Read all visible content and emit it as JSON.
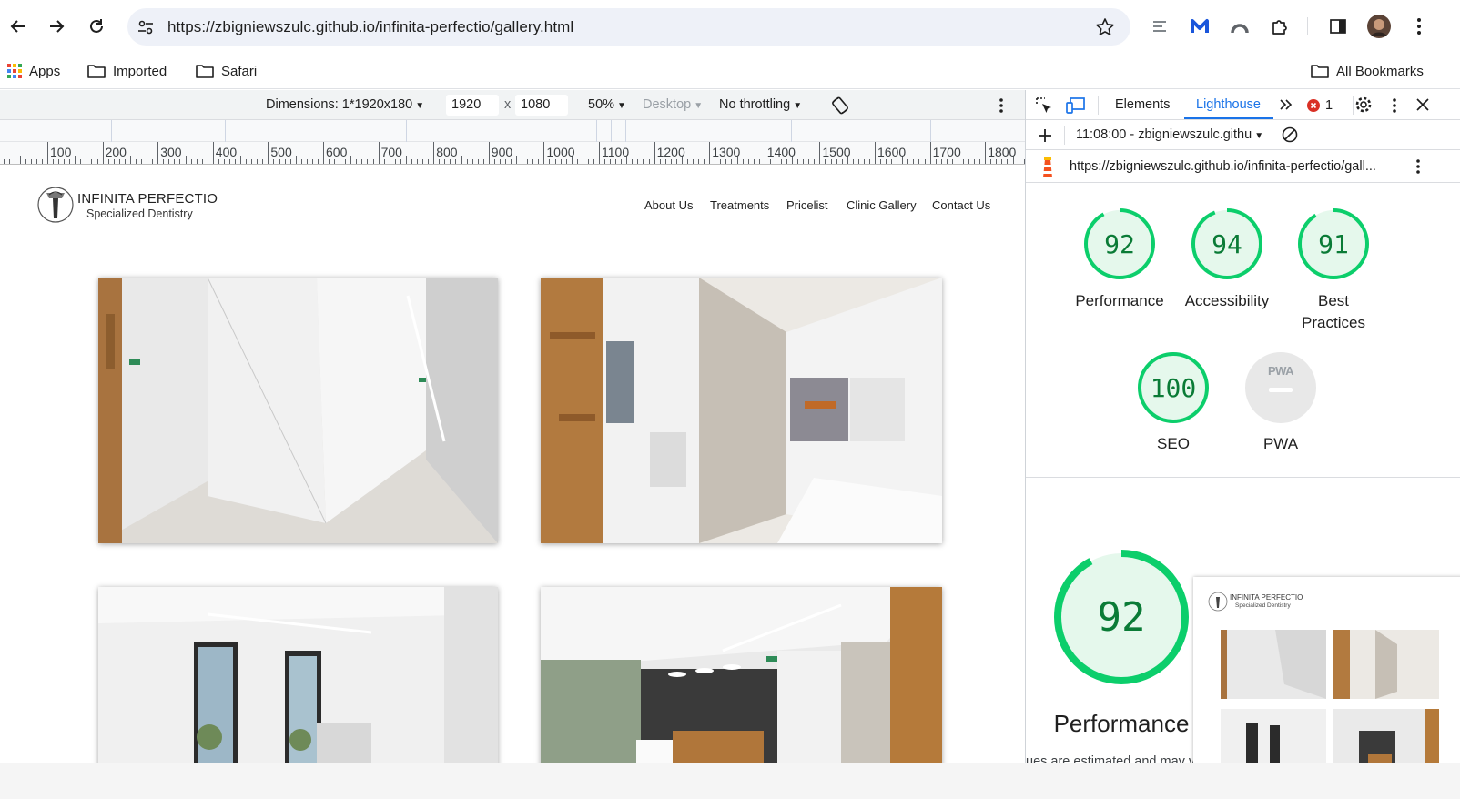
{
  "browser": {
    "url": "https://zbigniewszulc.github.io/infinita-perfectio/gallery.html",
    "bookmarks": [
      "Apps",
      "Imported",
      "Safari"
    ],
    "all_bookmarks": "All Bookmarks"
  },
  "device_toolbar": {
    "dimensions": "Dimensions: 1*1920x180",
    "width": "1920",
    "times": "x",
    "height": "1080",
    "zoom": "50%",
    "device_type": "Desktop",
    "throttling": "No throttling",
    "ruler_labels": [
      "100",
      "200",
      "300",
      "400",
      "500",
      "600",
      "700",
      "800",
      "900",
      "1000",
      "1100",
      "1200",
      "1300",
      "1400",
      "1500",
      "1600",
      "1700",
      "1800"
    ]
  },
  "site": {
    "brand_name": "INFINITA PERFECTIO",
    "brand_tagline": "Specialized Dentistry",
    "nav": [
      "About Us",
      "Treatments",
      "Pricelist",
      "Clinic Gallery",
      "Contact Us"
    ]
  },
  "devtools": {
    "tabs": [
      "Elements",
      "Lighthouse"
    ],
    "error_count": "1",
    "report_time": "11:08:00 - zbigniewszulc.githu",
    "report_url": "https://zbigniewszulc.github.io/infinita-perfectio/gall...",
    "scores": [
      {
        "value": 92,
        "label": "Performance"
      },
      {
        "value": 94,
        "label": "Accessibility"
      },
      {
        "value": 91,
        "label": "Best Practices"
      },
      {
        "value": 100,
        "label": "SEO"
      }
    ],
    "pwa_label": "PWA",
    "pwa_badge": "PWA",
    "pwa_value": "—",
    "big_score": {
      "value": 92,
      "label": "Performance"
    },
    "footnote": "ues are estimated and may va y. The",
    "thumb_brand": "INFINITA PERFECTIO",
    "thumb_tagline": "Specialized Dentistry"
  },
  "colors": {
    "score_green": "#0cce6b",
    "score_text": "#0a7b36",
    "score_bg": "#e5f8ec",
    "accent_blue": "#1a73e8"
  }
}
